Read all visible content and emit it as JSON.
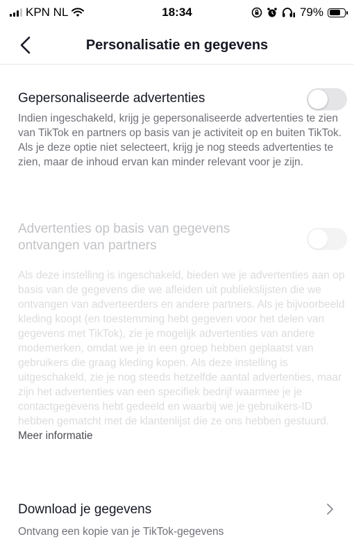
{
  "status_bar": {
    "carrier": "KPN NL",
    "time": "18:34",
    "battery_percent": "79%",
    "battery_level": 0.79
  },
  "header": {
    "title": "Personalisatie en gegevens"
  },
  "personalized_ads": {
    "title": "Gepersonaliseerde advertenties",
    "description": "Indien ingeschakeld, krijg je gepersonaliseerde advertenties te zien van TikTok en partners op basis van je activiteit op en buiten TikTok. Als je deze optie niet selecteert, krijg je nog steeds advertenties te zien, maar de inhoud ervan kan minder relevant voor je zijn.",
    "enabled": false
  },
  "partner_data_ads": {
    "title": "Advertenties op basis van gegevens ontvangen van partners",
    "description": "Als deze instelling is ingeschakeld, bieden we je advertenties aan op basis van de gegevens die we afleiden uit publiekslijsten die we ontvangen van adverteerders en andere partners. Als je bijvoorbeeld kleding koopt (en toestemming hebt gegeven voor het delen van gegevens met TikTok), zie je mogelijk advertenties van andere modemerken, omdat we je in een groep hebben geplaatst van gebruikers die graag kleding kopen. Als deze instelling is uitgeschakeld, zie je nog steeds hetzelfde aantal advertenties, maar zijn het advertenties van een specifiek bedrijf waarmee je je contactgegevens hebt gedeeld en waarbij we je gebruikers-ID hebben gematcht met de klantenlijst die ze ons hebben gestuurd.",
    "link": "Meer informatie",
    "enabled": false,
    "disabled": true
  },
  "download": {
    "title": "Download je gegevens",
    "description": "Ontvang een kopie van je TikTok-gegevens"
  }
}
